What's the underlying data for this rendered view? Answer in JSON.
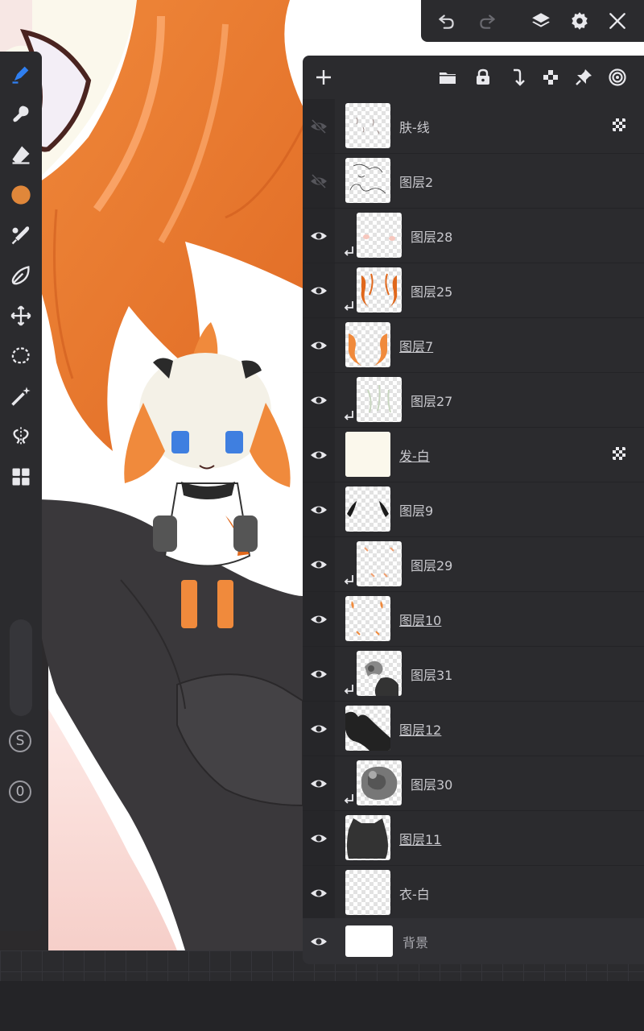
{
  "app": {
    "accent_color": "#2f7ff0",
    "brush_color": "#e0873a"
  },
  "top_bar": {
    "buttons": [
      "undo-icon",
      "redo-icon",
      "layers-icon",
      "settings-icon",
      "close-icon"
    ]
  },
  "toolbar": {
    "tools": [
      "brush-tool-icon",
      "smudge-tool-icon",
      "eraser-tool-icon",
      "color-swatch",
      "eyedropper-icon",
      "fill-tool-icon",
      "transform-icon",
      "lasso-selection-icon",
      "magic-wand-icon",
      "symmetry-icon",
      "quick-menu-icon"
    ],
    "symmetry_label": "S",
    "opacity_label": "0"
  },
  "layer_panel": {
    "header_buttons": [
      "add-layer-icon",
      "folder-icon",
      "lock-icon",
      "merge-down-icon",
      "alpha-lock-icon",
      "pin-icon",
      "blend-icon"
    ],
    "layers": [
      {
        "name": "肤-线",
        "visible": false,
        "clipped": false,
        "linked": false,
        "alpha_locked": true
      },
      {
        "name": "图层2",
        "visible": false,
        "clipped": false,
        "linked": false,
        "alpha_locked": false
      },
      {
        "name": "图层28",
        "visible": true,
        "clipped": true,
        "linked": false,
        "alpha_locked": false
      },
      {
        "name": "图层25",
        "visible": true,
        "clipped": true,
        "linked": false,
        "alpha_locked": false
      },
      {
        "name": "图层7",
        "visible": true,
        "clipped": false,
        "linked": true,
        "alpha_locked": false
      },
      {
        "name": "图层27",
        "visible": true,
        "clipped": true,
        "linked": false,
        "alpha_locked": false
      },
      {
        "name": "发-白",
        "visible": true,
        "clipped": false,
        "linked": true,
        "alpha_locked": true
      },
      {
        "name": "图层9",
        "visible": true,
        "clipped": false,
        "linked": false,
        "alpha_locked": false
      },
      {
        "name": "图层29",
        "visible": true,
        "clipped": true,
        "linked": false,
        "alpha_locked": false
      },
      {
        "name": "图层10",
        "visible": true,
        "clipped": false,
        "linked": true,
        "alpha_locked": false
      },
      {
        "name": "图层31",
        "visible": true,
        "clipped": true,
        "linked": false,
        "alpha_locked": false
      },
      {
        "name": "图层12",
        "visible": true,
        "clipped": false,
        "linked": true,
        "alpha_locked": false
      },
      {
        "name": "图层30",
        "visible": true,
        "clipped": true,
        "linked": false,
        "alpha_locked": false
      },
      {
        "name": "图层11",
        "visible": true,
        "clipped": false,
        "linked": true,
        "alpha_locked": false
      },
      {
        "name": "衣-白",
        "visible": true,
        "clipped": false,
        "linked": false,
        "alpha_locked": false
      }
    ],
    "background_layer": {
      "name": "背景",
      "visible": true
    }
  }
}
